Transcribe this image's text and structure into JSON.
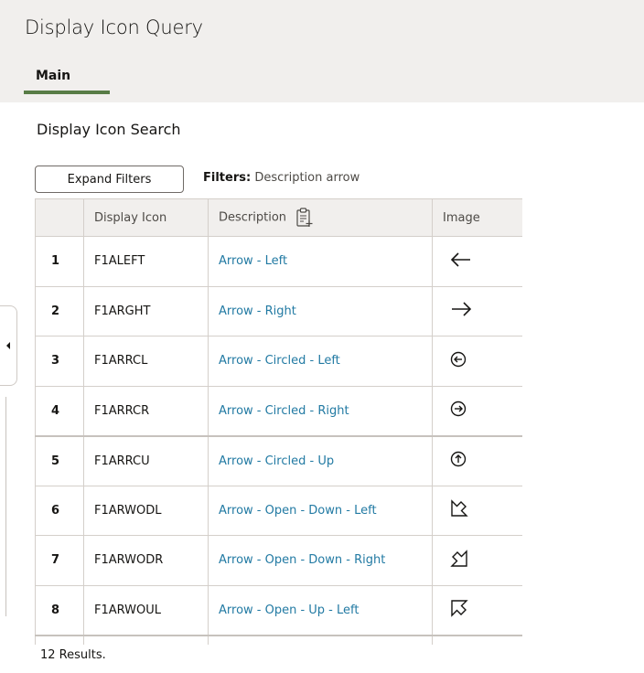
{
  "header": {
    "title": "Display Icon Query",
    "tabs": [
      {
        "label": "Main",
        "active": true
      }
    ]
  },
  "search": {
    "title": "Display Icon Search",
    "expand_filters_label": "Expand Filters",
    "filters_label": "Filters:",
    "filters_value": "Description arrow"
  },
  "grid": {
    "columns": {
      "num": "",
      "display_icon": "Display Icon",
      "description": "Description",
      "image": "Image"
    },
    "rows": [
      {
        "num": "1",
        "code": "F1ALEFT",
        "description": "Arrow - Left",
        "icon": "arrow-left-icon"
      },
      {
        "num": "2",
        "code": "F1ARGHT",
        "description": "Arrow - Right",
        "icon": "arrow-right-icon"
      },
      {
        "num": "3",
        "code": "F1ARRCL",
        "description": "Arrow - Circled - Left",
        "icon": "circled-arrow-left-icon"
      },
      {
        "num": "4",
        "code": "F1ARRCR",
        "description": "Arrow - Circled - Right",
        "icon": "circled-arrow-right-icon"
      },
      {
        "num": "5",
        "code": "F1ARRCU",
        "description": "Arrow - Circled - Up",
        "icon": "circled-arrow-up-icon"
      },
      {
        "num": "6",
        "code": "F1ARWODL",
        "description": "Arrow - Open - Down - Left",
        "icon": "open-arrow-down-left-icon"
      },
      {
        "num": "7",
        "code": "F1ARWODR",
        "description": "Arrow - Open - Down - Right",
        "icon": "open-arrow-down-right-icon"
      },
      {
        "num": "8",
        "code": "F1ARWOUL",
        "description": "Arrow - Open - Up - Left",
        "icon": "open-arrow-up-left-icon"
      }
    ]
  },
  "footer": {
    "results_text": "12 Results."
  },
  "colors": {
    "accent": "#587c46",
    "link": "#227aa3",
    "header_bg": "#f1efed"
  }
}
